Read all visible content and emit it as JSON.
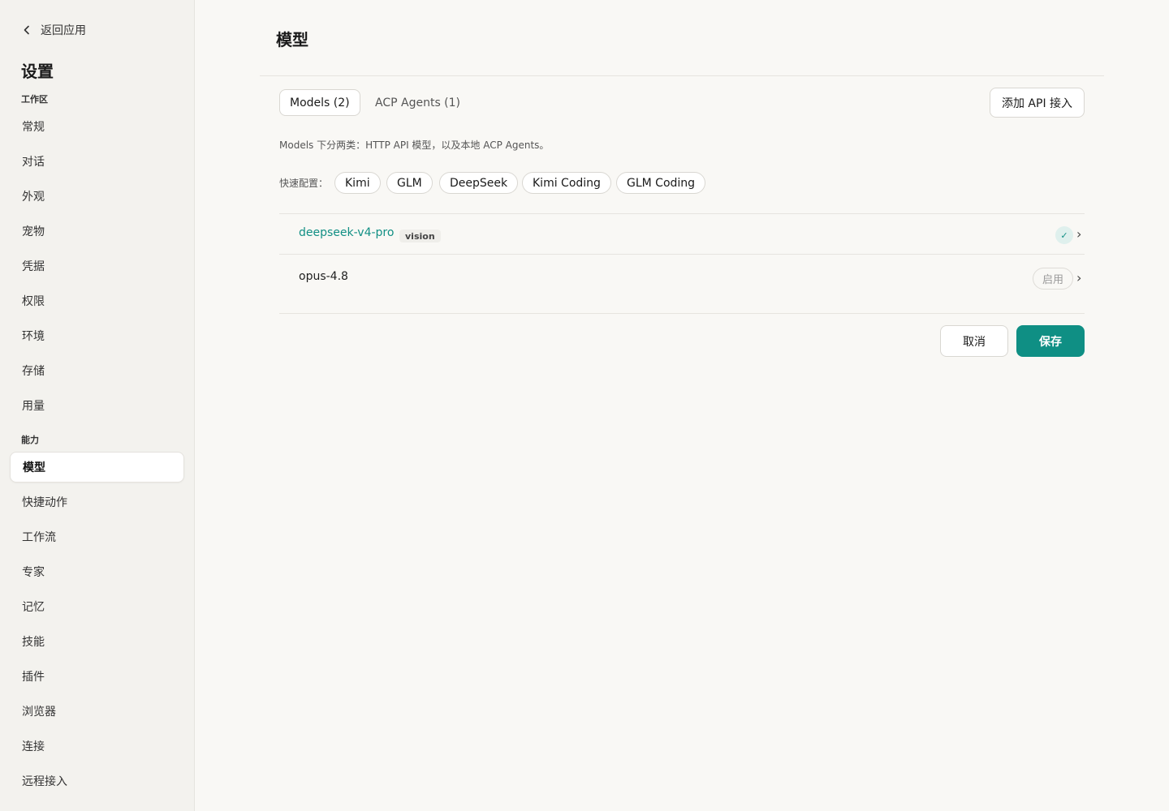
{
  "sidebar": {
    "back_label": "返回应用",
    "title": "设置",
    "groups": [
      {
        "label": "工作区"
      },
      {
        "label": "能力"
      }
    ],
    "items": [
      {
        "label": "常规"
      },
      {
        "label": "对话"
      },
      {
        "label": "外观"
      },
      {
        "label": "宠物"
      },
      {
        "label": "凭据"
      },
      {
        "label": "权限"
      },
      {
        "label": "环境"
      },
      {
        "label": "存储"
      },
      {
        "label": "用量"
      },
      {
        "label": "模型",
        "active": true
      },
      {
        "label": "快捷动作"
      },
      {
        "label": "工作流"
      },
      {
        "label": "专家"
      },
      {
        "label": "记忆"
      },
      {
        "label": "技能"
      },
      {
        "label": "插件"
      },
      {
        "label": "浏览器"
      },
      {
        "label": "连接"
      },
      {
        "label": "远程接入"
      }
    ]
  },
  "main": {
    "title": "模型",
    "tabs": [
      {
        "label": "Models (2)",
        "active": true
      },
      {
        "label": "ACP Agents (1)"
      }
    ],
    "add_button": "添加 API 接入",
    "description": "Models 下分两类：HTTP API 模型，以及本地 ACP Agents。",
    "quick_config_label": "快速配置：",
    "quick_chips": [
      "Kimi",
      "GLM",
      "DeepSeek",
      "Kimi Coding",
      "GLM Coding"
    ],
    "models": [
      {
        "name": "deepseek-v4-pro",
        "badge": "vision",
        "status": "✓",
        "enabled": true
      },
      {
        "name": "opus-4.8",
        "status_label": "启用",
        "enabled": false
      }
    ],
    "cancel_label": "取消",
    "save_label": "保存"
  },
  "colors": {
    "accent": "#0f8f84",
    "background": "#f9f8f5",
    "sidebar_bg": "#f3f2ee"
  }
}
